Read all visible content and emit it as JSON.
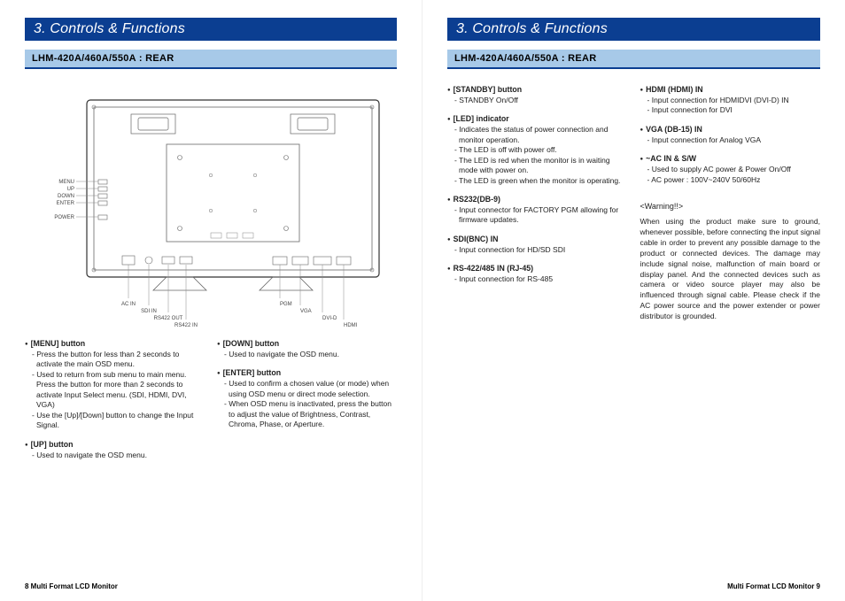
{
  "chapter": "3. Controls & Functions",
  "section": "LHM-420A/460A/550A : REAR",
  "diagram": {
    "left_labels": [
      "MENU",
      "UP",
      "DOWN",
      "ENTER",
      "POWER"
    ],
    "bottom_left": [
      "AC IN",
      "SDI IN",
      "RS422 OUT",
      "RS422 IN"
    ],
    "bottom_right": [
      "PGM",
      "VGA",
      "DVI-D",
      "HDMI"
    ]
  },
  "left_page": {
    "col1": [
      {
        "title": "[MENU] button",
        "lines": [
          "Press the button for less than 2 seconds to activate the main OSD menu.",
          "Used to return from sub menu to main menu. Press the button for more than 2 seconds to activate Input Select menu. (SDI, HDMI, DVI, VGA)",
          "Use the [Up]/[Down] button to change the Input Signal."
        ]
      },
      {
        "title": "[UP] button",
        "lines": [
          "Used to navigate the OSD menu."
        ]
      }
    ],
    "col2": [
      {
        "title": "[DOWN] button",
        "lines": [
          "Used to navigate the OSD menu."
        ]
      },
      {
        "title": "[ENTER] button",
        "lines": [
          "Used to confirm a chosen value (or mode) when using OSD menu or direct mode selection.",
          "When OSD menu is inactivated, press the button to adjust the value of Brightness, Contrast, Chroma, Phase, or Aperture."
        ]
      }
    ]
  },
  "right_page": {
    "col1": [
      {
        "title": "[STANDBY]  button",
        "lines": [
          "STANDBY On/Off"
        ]
      },
      {
        "title": "[LED]  indicator",
        "lines": [
          "Indicates the status of power connection and monitor operation.",
          "The LED is off with power off.",
          "The LED is red when the monitor is in waiting mode with power on.",
          "The LED is green when the monitor is operating."
        ]
      },
      {
        "title": "RS232(DB-9)",
        "lines": [
          "Input connector for FACTORY PGM allowing for firmware updates."
        ]
      },
      {
        "title": "SDI(BNC)  IN",
        "lines": [
          "Input connection for HD/SD SDI"
        ]
      },
      {
        "title": "RS-422/485 IN (RJ-45)",
        "lines": [
          "Input connection for RS-485"
        ]
      }
    ],
    "col2": [
      {
        "title": "HDMI (HDMI)  IN",
        "lines": [
          "Input connection for HDMIDVI (DVI-D)  IN",
          "Input connection for DVI"
        ]
      },
      {
        "title": "VGA (DB-15)  IN",
        "lines": [
          "Input connection for Analog VGA"
        ]
      },
      {
        "title": "~AC IN & S/W",
        "lines": [
          "Used to supply AC power & Power On/Off",
          "AC power : 100V~240V 50/60Hz"
        ]
      }
    ],
    "warning_head": "<Warning!!>",
    "warning_body": "When using the product make sure to ground, whenever possible, before connecting the input signal cable in order to prevent any possible damage to the product or connected devices. The damage may include signal noise, malfunction of main board or display panel. And the connected devices such as camera or video source player may also be influenced through signal cable. Please check if the AC power source and the power extender or power distributor is grounded."
  },
  "footer": {
    "left": "8  Multi Format LCD Monitor",
    "right": "Multi Format LCD Monitor  9"
  }
}
